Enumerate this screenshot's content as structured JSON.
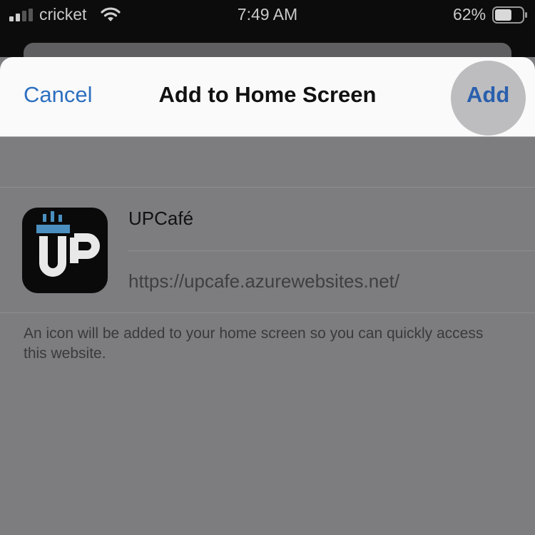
{
  "status_bar": {
    "carrier": "cricket",
    "time": "7:49 AM",
    "battery_percent": "62%",
    "battery_level": 0.62,
    "signal_bars": 2,
    "signal_bars_total": 4,
    "icons": [
      "signal-icon",
      "wifi-icon",
      "battery-icon"
    ]
  },
  "nav": {
    "cancel_label": "Cancel",
    "title": "Add to Home Screen",
    "add_label": "Add"
  },
  "form": {
    "app_name": "UPCafé",
    "url": "https://upcafe.azurewebsites.net/",
    "icon_name": "upcafe-app-icon"
  },
  "footnote": "An icon will be added to your home screen so you can quickly access this website.",
  "colors": {
    "accent": "#2d6fc0",
    "overlay": "#7d7d80",
    "icon_background": "#0a0a0a",
    "icon_blue": "#4a8fbf"
  }
}
